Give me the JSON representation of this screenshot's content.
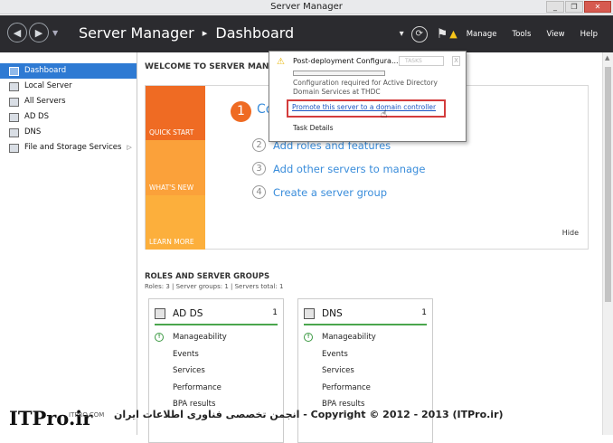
{
  "window": {
    "title": "Server Manager",
    "controls": [
      "_",
      "❐",
      "✕"
    ]
  },
  "header": {
    "breadcrumb": [
      "Server Manager",
      "Dashboard"
    ],
    "menu": [
      "Manage",
      "Tools",
      "View",
      "Help"
    ]
  },
  "sidebar": {
    "items": [
      {
        "label": "Dashboard",
        "icon": "dashboard-icon",
        "active": true
      },
      {
        "label": "Local Server",
        "icon": "server-icon"
      },
      {
        "label": "All Servers",
        "icon": "servers-icon"
      },
      {
        "label": "AD DS",
        "icon": "directory-icon"
      },
      {
        "label": "DNS",
        "icon": "dns-icon"
      },
      {
        "label": "File and Storage Services",
        "icon": "storage-icon",
        "chevron": "▷"
      }
    ]
  },
  "welcome": {
    "title": "WELCOME TO SERVER MANAGER",
    "tiles": [
      "QUICK START",
      "WHAT'S NEW",
      "LEARN MORE"
    ],
    "step1_num": "1",
    "step1_label": "Co",
    "steps": [
      {
        "num": "2",
        "label": "Add roles and features"
      },
      {
        "num": "3",
        "label": "Add other servers to manage"
      },
      {
        "num": "4",
        "label": "Create a server group"
      }
    ],
    "hide": "Hide"
  },
  "roles": {
    "title": "ROLES AND SERVER GROUPS",
    "subtitle": "Roles: 3   |   Server groups: 1   |   Servers total: 1",
    "cards": [
      {
        "name": "AD DS",
        "count": "1",
        "rows": [
          "Manageability",
          "Events",
          "Services",
          "Performance",
          "BPA results"
        ]
      },
      {
        "name": "DNS",
        "count": "1",
        "rows": [
          "Manageability",
          "Events",
          "Services",
          "Performance",
          "BPA results"
        ]
      }
    ]
  },
  "notification": {
    "title": "Post-deployment Configura...",
    "tasks_label": "TASKS",
    "close": "X",
    "description": "Configuration required for Active Directory Domain Services at THDC",
    "link": "Promote this server to a domain controller",
    "task_details": "Task Details"
  },
  "watermark": {
    "logo": "ITPro.ir",
    "small": "ITPRO.COM",
    "text": "انجمن تخصصی فناوری اطلاعات ایران - Copyright © 2012 - 2013 (ITPro.ir)"
  }
}
